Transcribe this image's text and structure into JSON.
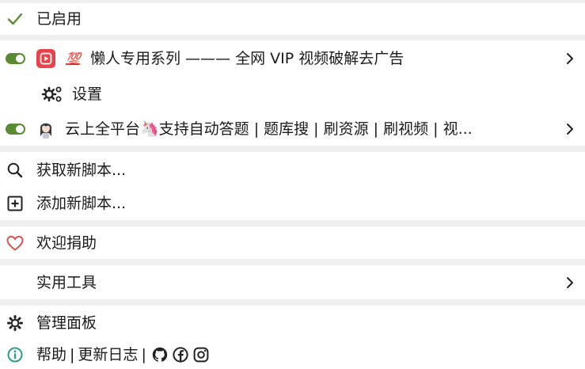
{
  "header": {
    "enabled_label": "已启用"
  },
  "scripts": [
    {
      "title": "💯 懒人专用系列 ——— 全网 VIP 视频破解去广告",
      "badge": "💯",
      "name": "懒人专用系列 ——— 全网 VIP 视频破解去广告",
      "enabled": true,
      "settings_label": "设置"
    },
    {
      "name": "云上全平台🦄支持自动答题 | 题库搜 | 刷资源 | 刷视频 | 视...",
      "enabled": true
    }
  ],
  "actions": {
    "get_new_script": "获取新脚本...",
    "add_new_script": "添加新脚本..."
  },
  "donate": {
    "label": "欢迎捐助"
  },
  "tools": {
    "label": "实用工具"
  },
  "dashboard": {
    "label": "管理面板"
  },
  "footer": {
    "help": "帮助",
    "separator": "|",
    "changelog": "更新日志",
    "separator2": "|"
  },
  "colors": {
    "accent_green": "#5a8a32",
    "heart_red": "#d9534f",
    "info_teal": "#2a9d8f",
    "logo_red": "#e8434a"
  },
  "icons": {
    "enabled": "check-icon",
    "settings": "gears-icon",
    "search": "search-icon",
    "add": "plus-square-icon",
    "donate": "heart-icon",
    "dashboard": "gear-icon",
    "help": "info-icon",
    "social": [
      "github-icon",
      "facebook-icon",
      "instagram-icon"
    ]
  }
}
